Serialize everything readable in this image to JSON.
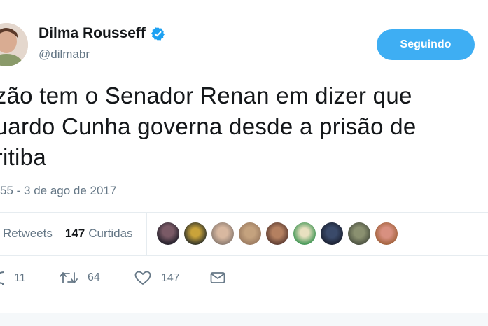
{
  "profile": {
    "name": "Dilma Rousseff",
    "handle": "@dilmabr",
    "follow_label": "Seguindo"
  },
  "tweet": {
    "text": "azão tem o Senador Renan em dizer que\nduardo Cunha governa desde a prisão de\nuritiba",
    "timestamp": "55 - 3 de ago de 2017"
  },
  "stats": {
    "retweets_label": "Retweets",
    "likes_count": "147",
    "likes_label": "Curtidas"
  },
  "actions": {
    "reply_count": "11",
    "retweet_count": "64",
    "like_count": "147"
  },
  "colors": {
    "accent": "#1da1f2",
    "text": "#14171a",
    "muted": "#657786"
  },
  "icons": {
    "verified": "verified-badge-icon",
    "reply": "reply-icon",
    "retweet": "retweet-icon",
    "like": "heart-icon",
    "dm": "envelope-icon"
  }
}
